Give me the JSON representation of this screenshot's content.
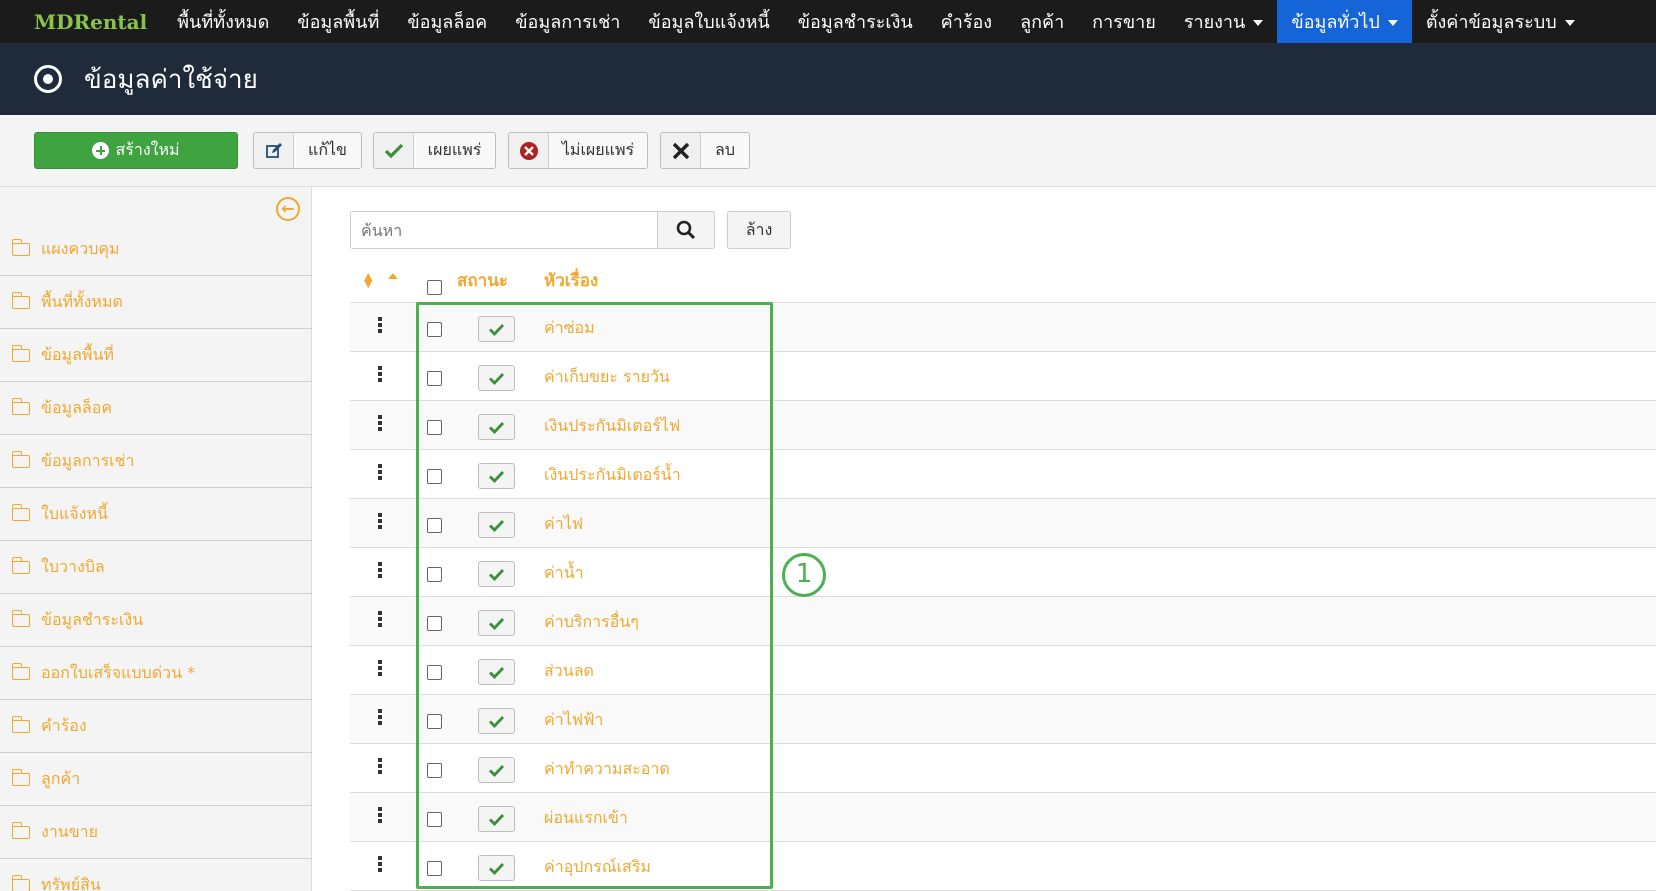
{
  "nav": {
    "brand": "MDRental",
    "items": [
      {
        "label": "พื้นที่ทั้งหมด",
        "dropdown": false,
        "active": false
      },
      {
        "label": "ข้อมูลพื้นที่",
        "dropdown": false,
        "active": false
      },
      {
        "label": "ข้อมูลล็อค",
        "dropdown": false,
        "active": false
      },
      {
        "label": "ข้อมูลการเช่า",
        "dropdown": false,
        "active": false
      },
      {
        "label": "ข้อมูลใบแจ้งหนี้",
        "dropdown": false,
        "active": false
      },
      {
        "label": "ข้อมูลชำระเงิน",
        "dropdown": false,
        "active": false
      },
      {
        "label": "คำร้อง",
        "dropdown": false,
        "active": false
      },
      {
        "label": "ลูกค้า",
        "dropdown": false,
        "active": false
      },
      {
        "label": "การขาย",
        "dropdown": false,
        "active": false
      },
      {
        "label": "รายงาน",
        "dropdown": true,
        "active": false
      },
      {
        "label": "ข้อมูลทั่วไป",
        "dropdown": true,
        "active": true
      },
      {
        "label": "ตั้งค่าข้อมูลระบบ",
        "dropdown": true,
        "active": false
      }
    ]
  },
  "page": {
    "title": "ข้อมูลค่าใช้จ่าย",
    "title_icon": "record-circle-icon"
  },
  "toolbar": {
    "new_label": "สร้างใหม่",
    "edit_label": "แก้ไข",
    "publish_label": "เผยแพร่",
    "unpublish_label": "ไม่เผยแพร่",
    "delete_label": "ลบ"
  },
  "sidebar": {
    "items": [
      {
        "label": "แผงควบคุม"
      },
      {
        "label": "พื้นที่ทั้งหมด"
      },
      {
        "label": "ข้อมูลพื้นที่"
      },
      {
        "label": "ข้อมูลล็อค"
      },
      {
        "label": "ข้อมูลการเช่า"
      },
      {
        "label": "ใบแจ้งหนี้"
      },
      {
        "label": "ใบวางบิล"
      },
      {
        "label": "ข้อมูลชำระเงิน"
      },
      {
        "label": "ออกใบเสร็จแบบด่วน *"
      },
      {
        "label": "คำร้อง"
      },
      {
        "label": "ลูกค้า"
      },
      {
        "label": "งานขาย"
      },
      {
        "label": "ทรัพย์สิน"
      }
    ]
  },
  "search": {
    "placeholder": "ค้นหา",
    "value": "",
    "clear_label": "ล้าง"
  },
  "table": {
    "headers": {
      "status": "สถานะ",
      "title": "หัวเรื่อง"
    },
    "rows": [
      {
        "title": "ค่าซ่อม",
        "published": true
      },
      {
        "title": "ค่าเก็บขยะ รายวัน",
        "published": true
      },
      {
        "title": "เงินประกันมิเตอร์ไฟ",
        "published": true
      },
      {
        "title": "เงินประกันมิเตอร์น้ำ",
        "published": true
      },
      {
        "title": "ค่าไฟ",
        "published": true
      },
      {
        "title": "ค่าน้ำ",
        "published": true
      },
      {
        "title": "ค่าบริการอื่นๆ",
        "published": true
      },
      {
        "title": "ส่วนลด",
        "published": true
      },
      {
        "title": "ค่าไฟฟ้า",
        "published": true
      },
      {
        "title": "ค่าทำความสะอาด",
        "published": true
      },
      {
        "title": "ผ่อนแรกเข้า",
        "published": true
      },
      {
        "title": "ค่าอุปกรณ์เสริม",
        "published": true
      }
    ]
  },
  "annotation": {
    "callout_number": "1"
  },
  "colors": {
    "nav_bg": "#1b1b1b",
    "nav_active": "#1565d8",
    "brand": "#8bc34a",
    "titlebar_bg": "#1f2a3a",
    "accent": "#f0a830",
    "new_button": "#3fa33f",
    "highlight": "#4caf50"
  }
}
